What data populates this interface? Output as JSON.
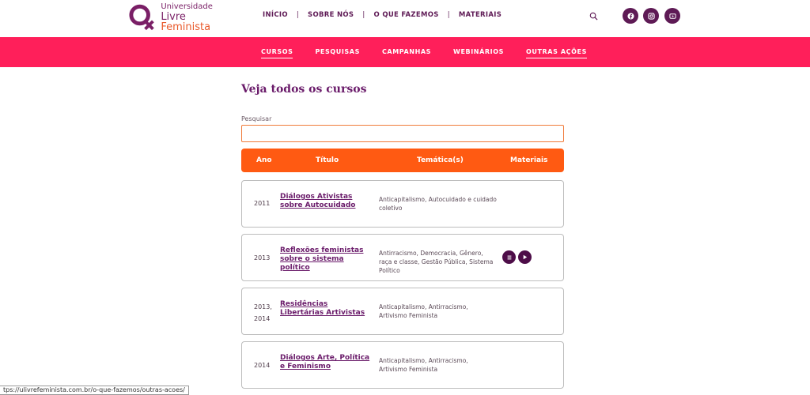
{
  "brand": {
    "line1": "Universidade",
    "line2a": "Livre",
    "line2b": "Feminista"
  },
  "nav": {
    "items": [
      "INÍCIO",
      "SOBRE NÓS",
      "O QUE FAZEMOS",
      "MATERIAIS"
    ],
    "separator": "|"
  },
  "icons": {
    "search": "search-icon",
    "social": [
      "facebook-icon",
      "instagram-icon",
      "youtube-icon"
    ]
  },
  "subnav": {
    "items": [
      "CURSOS",
      "PESQUISAS",
      "CAMPANHAS",
      "WEBINÁRIOS",
      "OUTRAS AÇÕES"
    ],
    "underlined": [
      "CURSOS",
      "OUTRAS AÇÕES"
    ]
  },
  "page": {
    "title": "Veja todos os cursos",
    "search_label": "Pesquisar",
    "search_value": ""
  },
  "table": {
    "headers": {
      "ano": "Ano",
      "titulo": "Título",
      "tematicas": "Temática(s)",
      "materiais": "Materiais"
    },
    "rows": [
      {
        "ano": "2011",
        "titulo": "Diálogos Ativistas sobre Autocuidado",
        "tematicas": "Anticapitalismo, Autocuidado e cuidado coletivo",
        "materiais": []
      },
      {
        "ano": "2013",
        "titulo": "Reflexões feministas sobre o sistema político",
        "tematicas": "Antirracismo, Democracia, Gênero, raça e classe, Gestão Pública, Sistema Político",
        "materiais": [
          "list-icon",
          "play-icon"
        ]
      },
      {
        "ano": "2013, 2014",
        "titulo": "Residências Libertárias Artivistas",
        "tematicas": "Anticapitalismo, Antirracismo, Artivismo Feminista",
        "materiais": []
      },
      {
        "ano": "2014",
        "titulo": "Diálogos Arte, Política e Feminismo",
        "tematicas": "Anticapitalismo, Antirracismo, Artivismo Feminista",
        "materiais": []
      }
    ]
  },
  "status": {
    "url": "tps://ulivrefeminista.com.br/o-que-fazemos/outras-acoes/"
  },
  "colors": {
    "purple": "#6a1b6a",
    "pink": "#ff1f5a",
    "orange": "#ff5a12"
  }
}
